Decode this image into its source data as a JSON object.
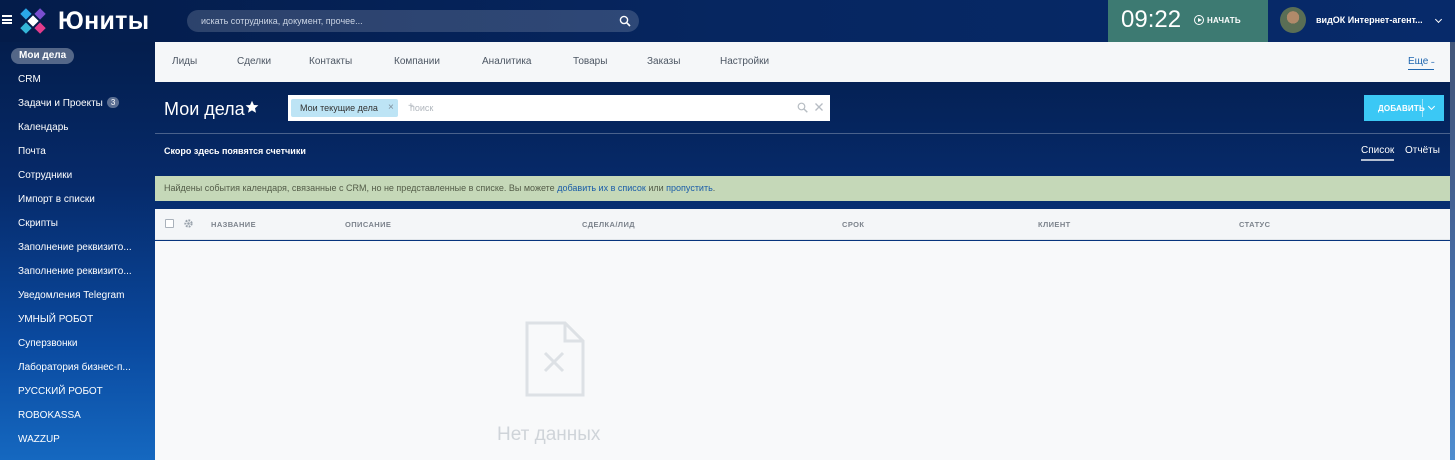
{
  "app": {
    "logo_text": "Юниты",
    "search_placeholder": "искать сотрудника, документ, прочее...",
    "clock": {
      "time": "09:22",
      "start_label": "НАЧАТЬ",
      "bg_color": "#3d7a72"
    },
    "user": {
      "name": "видОК Интернет-агент..."
    }
  },
  "sidebar": {
    "items": [
      {
        "label": "Мои дела",
        "active": true
      },
      {
        "label": "CRM"
      },
      {
        "label": "Задачи и Проекты",
        "badge": "3"
      },
      {
        "label": "Календарь"
      },
      {
        "label": "Почта"
      },
      {
        "label": "Сотрудники"
      },
      {
        "label": "Импорт в списки"
      },
      {
        "label": "Скрипты"
      },
      {
        "label": "Заполнение реквизито..."
      },
      {
        "label": "Заполнение реквизито..."
      },
      {
        "label": "Уведомления Telegram"
      },
      {
        "label": "УМНЫЙ РОБОТ"
      },
      {
        "label": "Суперзвонки"
      },
      {
        "label": "Лаборатория бизнес-п..."
      },
      {
        "label": "РУССКИЙ РОБОТ"
      },
      {
        "label": "ROBOKASSA"
      },
      {
        "label": "WAZZUP"
      }
    ]
  },
  "nav": {
    "tabs": [
      "Лиды",
      "Сделки",
      "Контакты",
      "Компании",
      "Аналитика",
      "Товары",
      "Заказы",
      "Настройки"
    ],
    "more_label": "Еще"
  },
  "page": {
    "title": "Мои дела",
    "filter": {
      "chip_label": "Мои текущие дела",
      "add_symbol": "+",
      "placeholder": "поиск"
    },
    "add_button_label": "ДОБАВИТЬ",
    "counters_note": "Скоро здесь появятся счетчики",
    "views": {
      "list": "Список",
      "reports": "Отчёты"
    },
    "notice": {
      "text_before": "Найдены события календаря, связанные с CRM, но не представленные в списке. Вы можете",
      "link_add": "добавить их в список",
      "text_or": "или",
      "link_skip": "пропустить",
      "text_after": "."
    }
  },
  "grid": {
    "columns": [
      "НАЗВАНИЕ",
      "ОПИСАНИЕ",
      "СДЕЛКА/ЛИД",
      "СРОК",
      "КЛИЕНТ",
      "СТАТУС"
    ],
    "empty_text": "Нет данных"
  },
  "colors": {
    "accent": "#3bc8f5",
    "notice_bg": "#c5d8b8",
    "link": "#1a5ca8"
  }
}
